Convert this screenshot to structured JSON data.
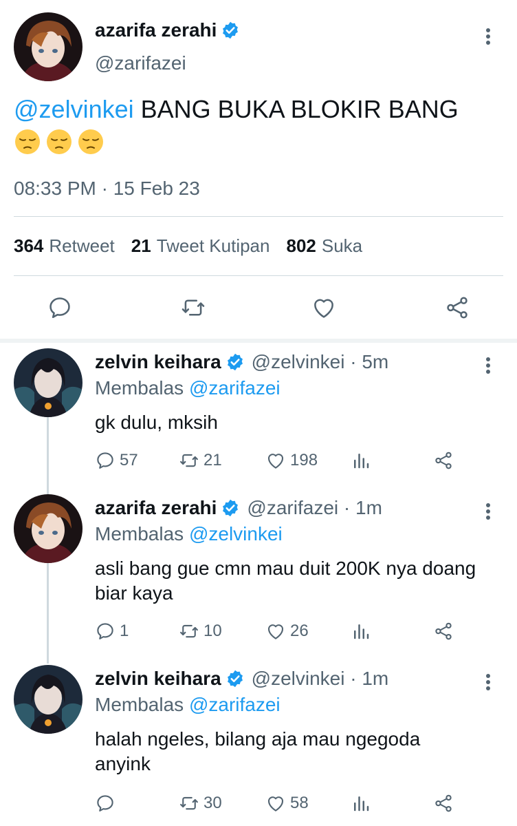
{
  "main_tweet": {
    "display_name": "azarifa zerahi",
    "handle": "@zarifazei",
    "mention": "@zelvinkei",
    "text": "BANG BUKA BLOKIR BANG",
    "emoji_count": 3,
    "emoji": "pensive-face",
    "timestamp": "08:33 PM · 15 Feb 23",
    "stats": {
      "retweets_value": "364",
      "retweets_label": "Retweet",
      "quotes_value": "21",
      "quotes_label": "Tweet Kutipan",
      "likes_value": "802",
      "likes_label": "Suka"
    }
  },
  "replies": [
    {
      "display_name": "zelvin keihara",
      "handle": "@zelvinkei · 5m",
      "replying_prefix": "Membalas",
      "replying_to": "@zarifazei",
      "text": "gk dulu, mksih",
      "replies": "57",
      "retweets": "21",
      "likes": "198"
    },
    {
      "display_name": "azarifa zerahi",
      "handle": "@zarifazei · 1m",
      "replying_prefix": "Membalas",
      "replying_to": "@zelvinkei",
      "text": "asli bang gue cmn mau duit 200K nya doang biar kaya",
      "replies": "1",
      "retweets": "10",
      "likes": "26"
    },
    {
      "display_name": "zelvin keihara",
      "handle": "@zelvinkei · 1m",
      "replying_prefix": "Membalas",
      "replying_to": "@zarifazei",
      "text": "halah ngeles, bilang aja mau ngegoda anyink",
      "replies": "",
      "retweets": "30",
      "likes": "58"
    }
  ],
  "colors": {
    "accent": "#1d9bf0",
    "secondary_text": "#536471",
    "divider": "#cfd9de"
  }
}
